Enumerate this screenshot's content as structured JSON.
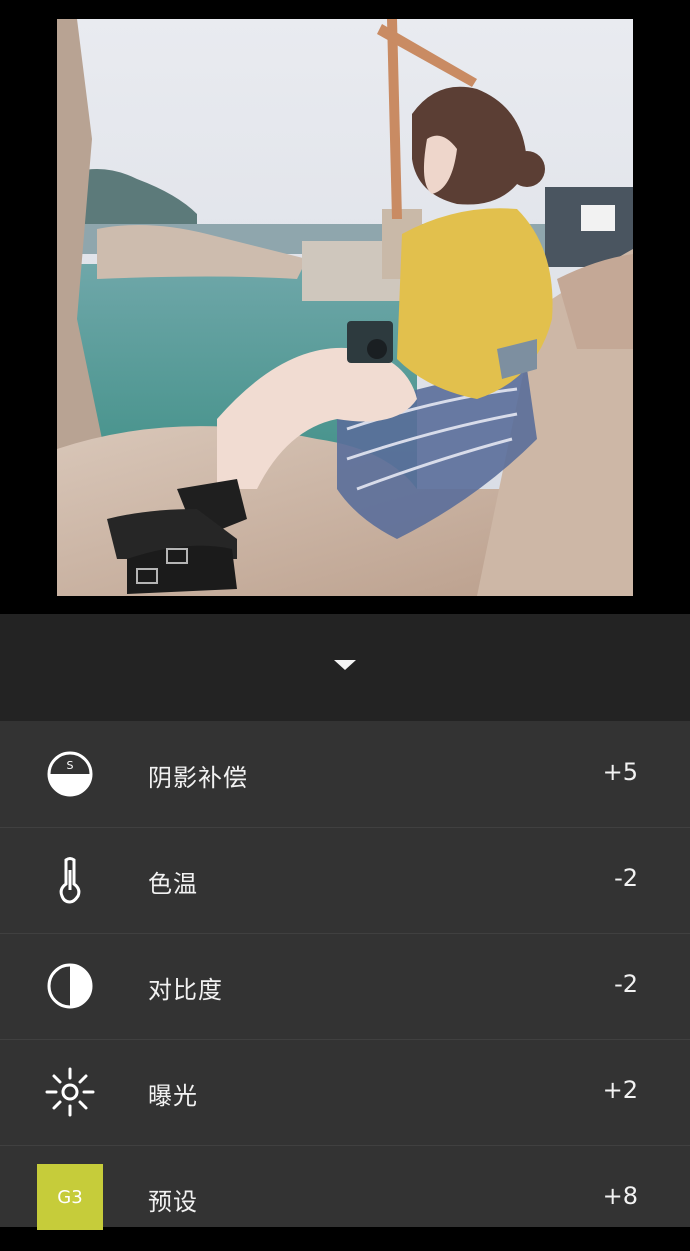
{
  "photo": {
    "description_icon": "photo-image"
  },
  "panel": {
    "collapse_icon": "chevron-down-icon"
  },
  "adjustments": [
    {
      "label": "阴影补偿",
      "value": "+5",
      "icon": "shadow-compensation-icon",
      "icon_letter": "S"
    },
    {
      "label": "色温",
      "value": "-2",
      "icon": "thermometer-icon"
    },
    {
      "label": "对比度",
      "value": "-2",
      "icon": "contrast-icon"
    },
    {
      "label": "曝光",
      "value": "+2",
      "icon": "exposure-sun-icon"
    },
    {
      "label": "预设",
      "value": "+8",
      "icon": "preset-badge",
      "badge": "G3"
    }
  ],
  "colors": {
    "panel_bg": "#333333",
    "header_bg": "#232323",
    "badge_bg": "#c6cc3a"
  }
}
